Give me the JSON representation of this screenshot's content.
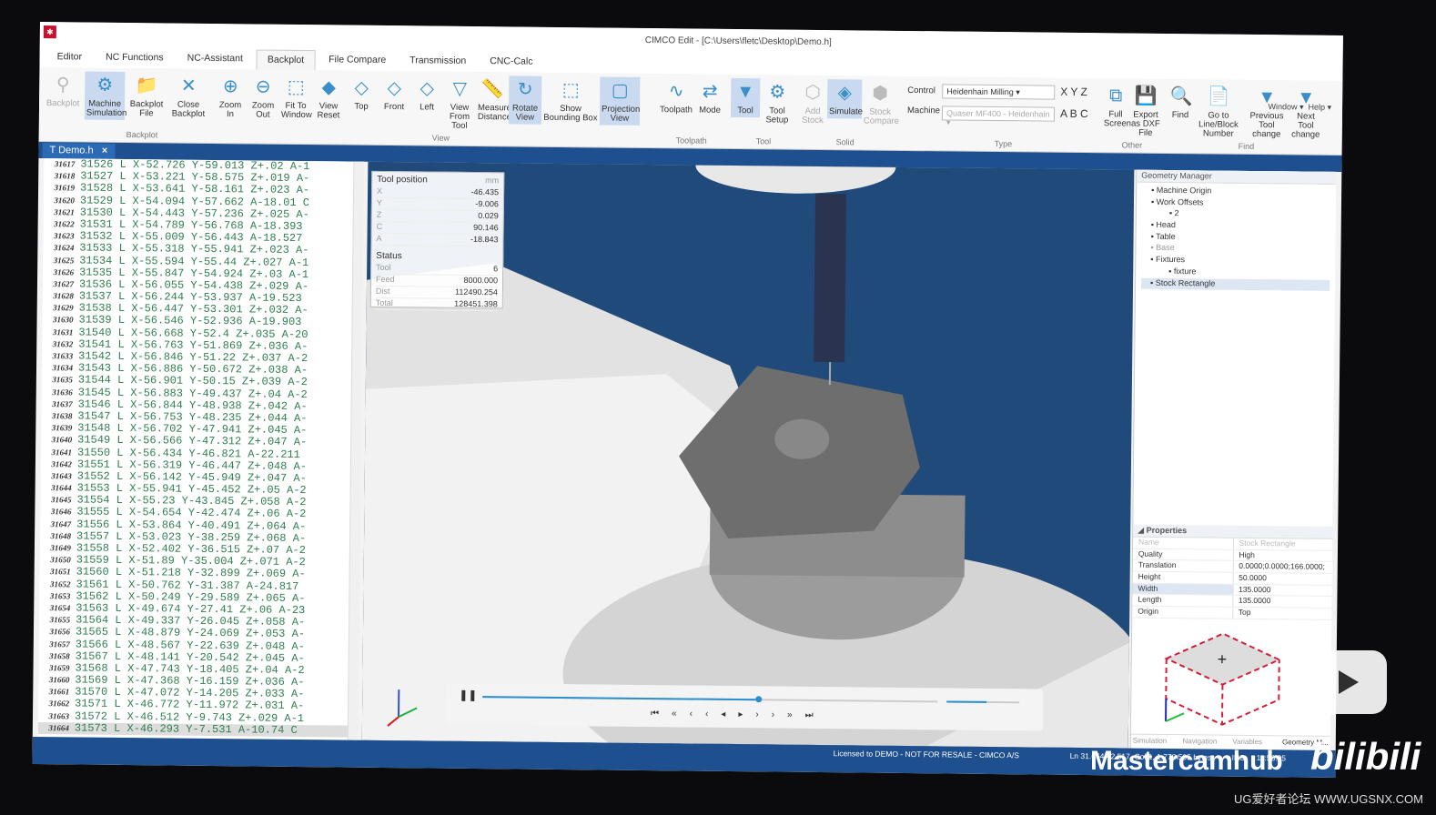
{
  "app": {
    "title": "CIMCO Edit - [C:\\Users\\fletc\\Desktop\\Demo.h]",
    "window_menu": "Window",
    "help_menu": "Help"
  },
  "tabs": [
    "Editor",
    "NC Functions",
    "NC-Assistant",
    "Backplot",
    "File Compare",
    "Transmission",
    "CNC-Calc"
  ],
  "ribbon": {
    "backplot": [
      "Backplot",
      "Machine Simulation",
      "Backplot File",
      "Close Backplot"
    ],
    "backplot_group": "Backplot",
    "view": [
      "Zoom In",
      "Zoom Out",
      "Fit To Window",
      "View Reset",
      "Top",
      "Front",
      "Left",
      "View From Tool",
      "Measure Distance",
      "Rotate View",
      "Show Bounding Box",
      "Projection View"
    ],
    "view_group": "View",
    "toolpath": [
      "Toolpath",
      "Mode"
    ],
    "toolpath_group": "Toolpath",
    "tool": [
      "Tool",
      "Tool Setup"
    ],
    "tool_group": "Tool",
    "solid": [
      "Add Stock",
      "Simulate",
      "Stock Compare"
    ],
    "solid_group": "Solid",
    "control_label": "Control",
    "control_value": "Heidenhain Milling",
    "machine_label": "Machine",
    "machine_value": "Quaser MF400 - Heidenhain",
    "axes1": "X Y Z",
    "axes2": "A B C",
    "type_group": "Type",
    "other": [
      "Full Screen",
      "Export as DXF File"
    ],
    "other_group": "Other",
    "find": [
      "Find",
      "Go to Line/Block Number",
      "Previous Tool change",
      "Next Tool change"
    ],
    "find_group": "Find"
  },
  "document_tab": "Demo.h",
  "editor_lines": [
    [
      "31617",
      "31526 L X-52.726 Y-59.013 Z+.02 A-1"
    ],
    [
      "31618",
      "31527 L X-53.221 Y-58.575 Z+.019 A-"
    ],
    [
      "31619",
      "31528 L X-53.641 Y-58.161 Z+.023 A-"
    ],
    [
      "31620",
      "31529 L X-54.094 Y-57.662 A-18.01 C"
    ],
    [
      "31621",
      "31530 L X-54.443 Y-57.236 Z+.025 A-"
    ],
    [
      "31622",
      "31531 L X-54.789 Y-56.768 A-18.393"
    ],
    [
      "31623",
      "31532 L X-55.009 Y-56.443 A-18.527"
    ],
    [
      "31624",
      "31533 L X-55.318 Y-55.941 Z+.023 A-"
    ],
    [
      "31625",
      "31534 L X-55.594 Y-55.44 Z+.027 A-1"
    ],
    [
      "31626",
      "31535 L X-55.847 Y-54.924 Z+.03 A-1"
    ],
    [
      "31627",
      "31536 L X-56.055 Y-54.438 Z+.029 A-"
    ],
    [
      "31628",
      "31537 L X-56.244 Y-53.937 A-19.523"
    ],
    [
      "31629",
      "31538 L X-56.447 Y-53.301 Z+.032 A-"
    ],
    [
      "31630",
      "31539 L X-56.546 Y-52.936 A-19.903"
    ],
    [
      "31631",
      "31540 L X-56.668 Y-52.4 Z+.035 A-20"
    ],
    [
      "31632",
      "31541 L X-56.763 Y-51.869 Z+.036 A-"
    ],
    [
      "31633",
      "31542 L X-56.846 Y-51.22 Z+.037 A-2"
    ],
    [
      "31634",
      "31543 L X-56.886 Y-50.672 Z+.038 A-"
    ],
    [
      "31635",
      "31544 L X-56.901 Y-50.15 Z+.039 A-2"
    ],
    [
      "31636",
      "31545 L X-56.883 Y-49.437 Z+.04 A-2"
    ],
    [
      "31637",
      "31546 L X-56.844 Y-48.938 Z+.042 A-"
    ],
    [
      "31638",
      "31547 L X-56.753 Y-48.235 Z+.044 A-"
    ],
    [
      "31639",
      "31548 L X-56.702 Y-47.941 Z+.045 A-"
    ],
    [
      "31640",
      "31549 L X-56.566 Y-47.312 Z+.047 A-"
    ],
    [
      "31641",
      "31550 L X-56.434 Y-46.821 A-22.211"
    ],
    [
      "31642",
      "31551 L X-56.319 Y-46.447 Z+.048 A-"
    ],
    [
      "31643",
      "31552 L X-56.142 Y-45.949 Z+.047 A-"
    ],
    [
      "31644",
      "31553 L X-55.941 Y-45.452 Z+.05 A-2"
    ],
    [
      "31645",
      "31554 L X-55.23 Y-43.845 Z+.058 A-2"
    ],
    [
      "31646",
      "31555 L X-54.654 Y-42.474 Z+.06 A-2"
    ],
    [
      "31647",
      "31556 L X-53.864 Y-40.491 Z+.064 A-"
    ],
    [
      "31648",
      "31557 L X-53.023 Y-38.259 Z+.068 A-"
    ],
    [
      "31649",
      "31558 L X-52.402 Y-36.515 Z+.07 A-2"
    ],
    [
      "31650",
      "31559 L X-51.89 Y-35.004 Z+.071 A-2"
    ],
    [
      "31651",
      "31560 L X-51.218 Y-32.899 Z+.069 A-"
    ],
    [
      "31652",
      "31561 L X-50.762 Y-31.387 A-24.817"
    ],
    [
      "31653",
      "31562 L X-50.249 Y-29.589 Z+.065 A-"
    ],
    [
      "31654",
      "31563 L X-49.674 Y-27.41 Z+.06 A-23"
    ],
    [
      "31655",
      "31564 L X-49.337 Y-26.045 Z+.058 A-"
    ],
    [
      "31656",
      "31565 L X-48.879 Y-24.069 Z+.053 A-"
    ],
    [
      "31657",
      "31566 L X-48.567 Y-22.639 Z+.048 A-"
    ],
    [
      "31658",
      "31567 L X-48.141 Y-20.542 Z+.045 A-"
    ],
    [
      "31659",
      "31568 L X-47.743 Y-18.405 Z+.04 A-2"
    ],
    [
      "31660",
      "31569 L X-47.368 Y-16.159 Z+.036 A-"
    ],
    [
      "31661",
      "31570 L X-47.072 Y-14.205 Z+.033 A-"
    ],
    [
      "31662",
      "31571 L X-46.772 Y-11.972 Z+.031 A-"
    ],
    [
      "31663",
      "31572 L X-46.512 Y-9.743 Z+.029 A-1"
    ],
    [
      "31664",
      "31573 L X-46.293 Y-7.531 A-10.74 C"
    ]
  ],
  "tool_position": {
    "title": "Tool position",
    "unit": "mm",
    "rows": [
      [
        "X",
        "-46.435"
      ],
      [
        "Y",
        "-9.006"
      ],
      [
        "Z",
        "0.029"
      ],
      [
        "C",
        "90.146"
      ],
      [
        "A",
        "-18.843"
      ]
    ]
  },
  "status_panel": {
    "title": "Status",
    "rows": [
      [
        "Tool",
        "6"
      ],
      [
        "Feed",
        "8000.000"
      ],
      [
        "Dist",
        "112490.254"
      ],
      [
        "Total",
        "128451.398"
      ]
    ]
  },
  "playback": {
    "progress": 0.6,
    "speed": 0.55
  },
  "geometry_manager": {
    "title": "Geometry Manager",
    "items": [
      [
        "Machine Origin",
        "1"
      ],
      [
        "Work Offsets",
        "1"
      ],
      [
        "2",
        "2"
      ],
      [
        "Head",
        "1"
      ],
      [
        "Table",
        "1"
      ],
      [
        "Base",
        "1"
      ],
      [
        "Fixtures",
        "1"
      ],
      [
        "fixture",
        "2"
      ],
      [
        "Stock Rectangle",
        "1"
      ]
    ]
  },
  "properties": {
    "title": "Properties",
    "rows": [
      [
        "Name",
        "Stock Rectangle"
      ],
      [
        "Quality",
        "High"
      ],
      [
        "Translation",
        "0.0000;0.0000;166.0000;"
      ],
      [
        "Height",
        "50.0000"
      ],
      [
        "Width",
        "135.0000"
      ],
      [
        "Length",
        "135.0000"
      ],
      [
        "Origin",
        "Top"
      ]
    ]
  },
  "bottom_tabs": [
    "Simulation",
    "Navigation",
    "Variables",
    "Geometry M..."
  ],
  "statusbar": {
    "license": "Licensed to DEMO - NOT FOR RESALE - CIMCO A/S",
    "position": "Ln 31.664/42.517, Col 1, 1.778.505 bytes",
    "mode": "INS",
    "time": "11:56:05"
  },
  "watermark": {
    "channel": "Mastercamhub",
    "brand": "bilibili",
    "forum": "UG爱好者论坛 WWW.UGSNX.COM"
  }
}
